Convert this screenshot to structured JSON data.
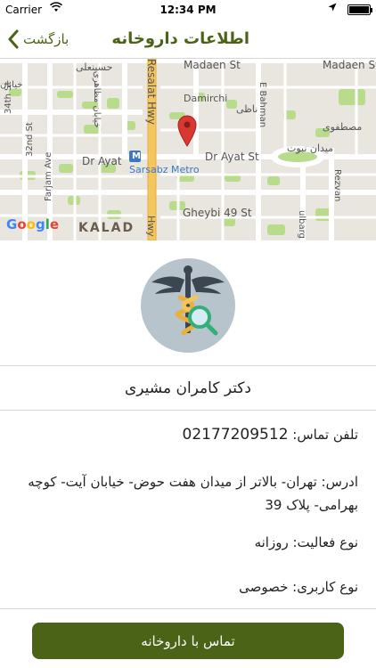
{
  "status_bar": {
    "carrier": "Carrier",
    "time": "12:34 PM",
    "battery_level": 1.0
  },
  "nav": {
    "back_label": "بازگشت",
    "title": "اطلاعات داروخانه"
  },
  "map": {
    "labels": {
      "madaen_1": "Madaen St",
      "madaen_2": "Madaen St",
      "hosseinali": "حسینعلی",
      "khiaban_1": "خیابان",
      "khiaban_mazaheri": "خیابان مظاهری",
      "resalat": "Resalat Hwy",
      "damirchi": "Damirchi",
      "bahman": "E Bahman",
      "nazi": "ناظی",
      "mostafavi": "مصطفوی",
      "street_34": "34th St",
      "street_32": "32nd St",
      "farjam": "Farjam Ave",
      "dr_ayat_1": "Dr Ayat",
      "dr_ayat_2": "Dr Ayat St",
      "meydan": "میدان نبوت",
      "sarsabz": "Sarsabz Metro",
      "metro_badge": "M",
      "rezvan": "Rezvan",
      "gheybi": "Gheybi 49 St",
      "kalad": "KALAD",
      "hwy": "Hwy",
      "ulbarg": "ulbarg St",
      "google": [
        "G",
        "o",
        "o",
        "g",
        "l",
        "e"
      ]
    }
  },
  "profile": {
    "icon": "caduceus-magnifier-icon",
    "name": "دکتر کامران مشیری"
  },
  "details": {
    "phone_label": "تلفن تماس:",
    "phone_value": "02177209512",
    "address_label": "ادرس:",
    "address_value": "تهران- بالاتر از میدان هفت حوض- خیابان آیت- کوچه بهرامی- پلاک 39",
    "activity_label": "نوع فعالیت:",
    "activity_value": "روزانه",
    "usage_label": "نوع کاربری:",
    "usage_value": "خصوصی"
  },
  "actions": {
    "call_label": "تماس با داروخانه"
  },
  "colors": {
    "accent": "#4b6316",
    "map_bg": "#e9e6df",
    "park": "#b8dc8c",
    "highway": "#f4c75e",
    "pin": "#d93732"
  }
}
